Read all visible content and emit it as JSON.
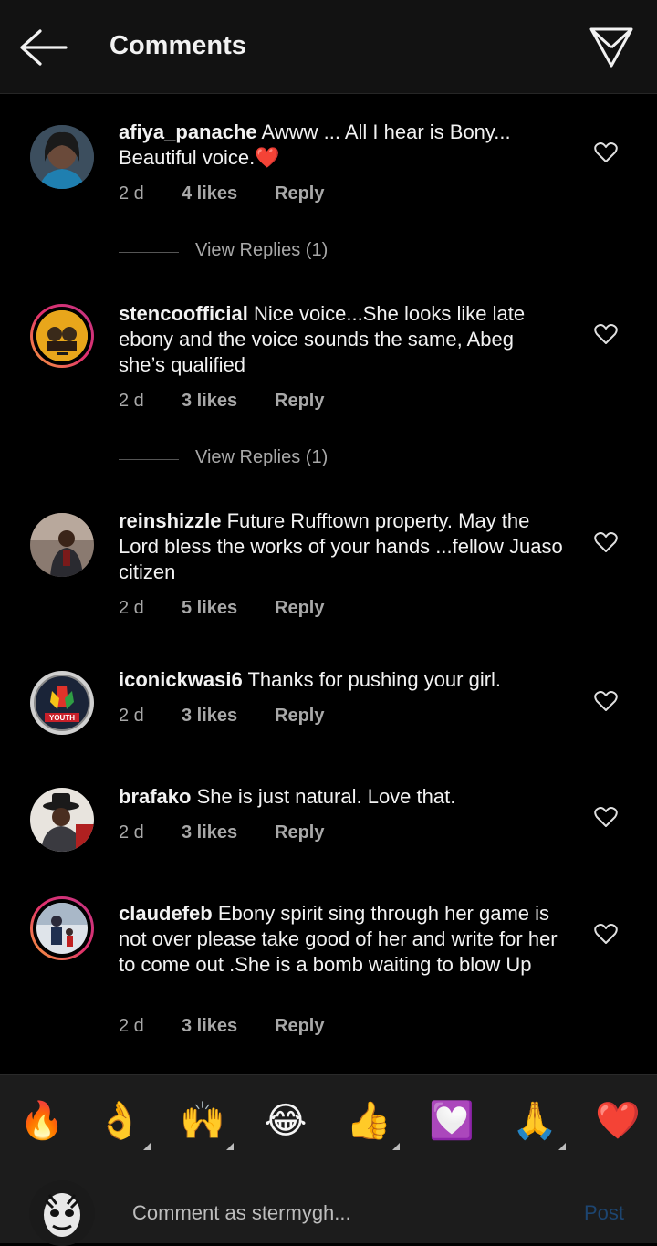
{
  "header": {
    "title": "Comments"
  },
  "comments": [
    {
      "user": "afiya_panache",
      "text": "Awww ... All I hear is Bony... Beautiful voice.❤️",
      "time": "2 d",
      "likes": "4 likes",
      "reply": "Reply",
      "view_replies": "View Replies (1)"
    },
    {
      "user": "stencoofficial",
      "text": "Nice voice...She looks like late ebony and the voice sounds the same, Abeg she’s qualified",
      "time": "2 d",
      "likes": "3 likes",
      "reply": "Reply",
      "view_replies": "View Replies (1)"
    },
    {
      "user": "reinshizzle",
      "text": "Future Rufftown property. May the Lord bless the works of your hands ...fellow Juaso citizen",
      "time": "2 d",
      "likes": "5 likes",
      "reply": "Reply"
    },
    {
      "user": "iconickwasi6",
      "text": "Thanks for pushing your girl.",
      "time": "2 d",
      "likes": "3 likes",
      "reply": "Reply"
    },
    {
      "user": "brafako",
      "text": "She is just natural. Love that.",
      "time": "2 d",
      "likes": "3 likes",
      "reply": "Reply"
    },
    {
      "user": "claudefeb",
      "text": "Ebony spirit sing through her game is not over please take good of her and write for her to come out .She is a bomb waiting to blow Up",
      "time": "2 d",
      "likes": "3 likes",
      "reply": "Reply"
    }
  ],
  "reactions": [
    "🔥",
    "👌",
    "🙌",
    "😂",
    "👍",
    "💟",
    "🙏",
    "❤️"
  ],
  "composer": {
    "placeholder": "Comment as stermygh...",
    "post_label": "Post"
  },
  "colors": {
    "background": "#000000",
    "header": "#121212",
    "emoji_bar": "#1c1c1c",
    "post_disabled": "#1d4570",
    "muted_text": "#a8a8a8"
  }
}
